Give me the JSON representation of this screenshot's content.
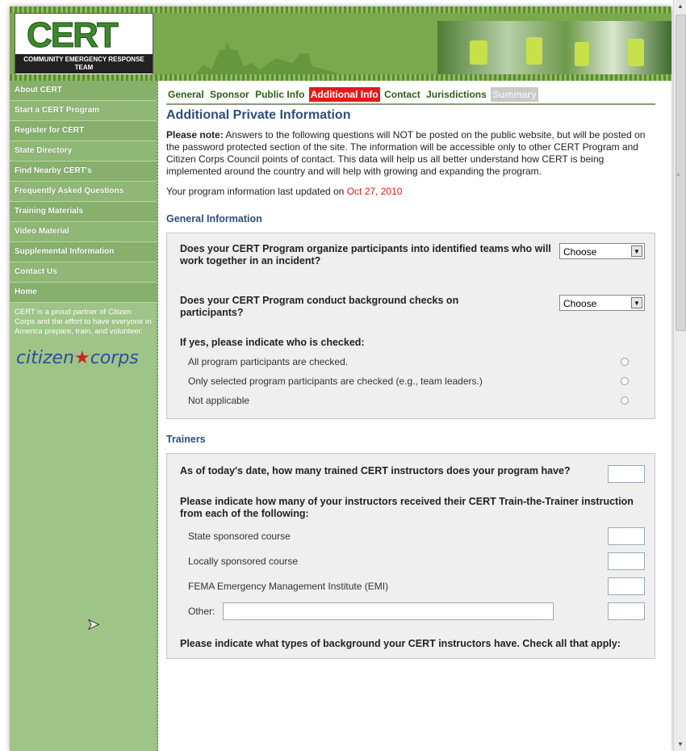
{
  "header": {
    "logo_text": "CERT",
    "logo_subtitle": "COMMUNITY EMERGENCY RESPONSE TEAM"
  },
  "sidebar": {
    "items": [
      {
        "label": "About CERT"
      },
      {
        "label": "Start a CERT Program"
      },
      {
        "label": "Register for CERT"
      },
      {
        "label": "State Directory"
      },
      {
        "label": "Find Nearby CERT's"
      },
      {
        "label": "Frequently Asked Questions"
      },
      {
        "label": "Training Materials"
      },
      {
        "label": "Video Material"
      },
      {
        "label": "Supplemental Information"
      },
      {
        "label": "Contact Us"
      },
      {
        "label": "Home"
      }
    ],
    "partner_text": "CERT is a proud partner of Citizen Corps and the effort to have everyone in America prepare, train, and volunteer.",
    "citizen_corps_logo_part1": "citizen",
    "citizen_corps_logo_part2": "corps"
  },
  "tabs": [
    {
      "label": "General",
      "state": "normal"
    },
    {
      "label": "Sponsor",
      "state": "normal"
    },
    {
      "label": "Public Info",
      "state": "normal"
    },
    {
      "label": "Additional Info",
      "state": "active"
    },
    {
      "label": "Contact",
      "state": "normal"
    },
    {
      "label": "Jurisdictions",
      "state": "normal"
    },
    {
      "label": "Summary",
      "state": "disabled"
    }
  ],
  "page_title": "Additional Private Information",
  "note": {
    "bold": "Please note:",
    "text": " Answers to the following questions will NOT be posted on the public website, but will be posted on the password protected section of the site. The information will be accessible only to other CERT Program and Citizen Corps Council points of contact. This data will help us all better understand how CERT is being implemented around the country and will help with growing and expanding the program."
  },
  "updated": {
    "prefix": "Your program information last updated on ",
    "date": "Oct 27, 2010"
  },
  "general": {
    "title": "General Information",
    "q1": "Does your CERT Program organize participants into identified teams who will work together in an incident?",
    "q1_select": "Choose",
    "q2": "Does your CERT Program conduct background checks on participants?",
    "q2_select": "Choose",
    "q3": "If yes, please indicate who is checked:",
    "options": [
      {
        "label": "All program participants are checked."
      },
      {
        "label": "Only selected program participants are checked (e.g., team leaders.)"
      },
      {
        "label": "Not applicable"
      }
    ]
  },
  "trainers": {
    "title": "Trainers",
    "q1": "As of today's date, how many trained CERT instructors does your program have?",
    "q2": "Please indicate how many of your instructors received their CERT Train-the-Trainer instruction from each of the following:",
    "sources": [
      {
        "label": "State sponsored course"
      },
      {
        "label": "Locally sponsored course"
      },
      {
        "label": "FEMA Emergency Management Institute (EMI)"
      }
    ],
    "other_label": "Other:",
    "q3": "Please indicate what types of background your CERT instructors have. Check all that apply:"
  },
  "colors": {
    "accent_green": "#7aa84d",
    "active_tab": "#e21a1a",
    "heading_blue": "#2d4f7a",
    "date_red": "#d61c1c"
  }
}
